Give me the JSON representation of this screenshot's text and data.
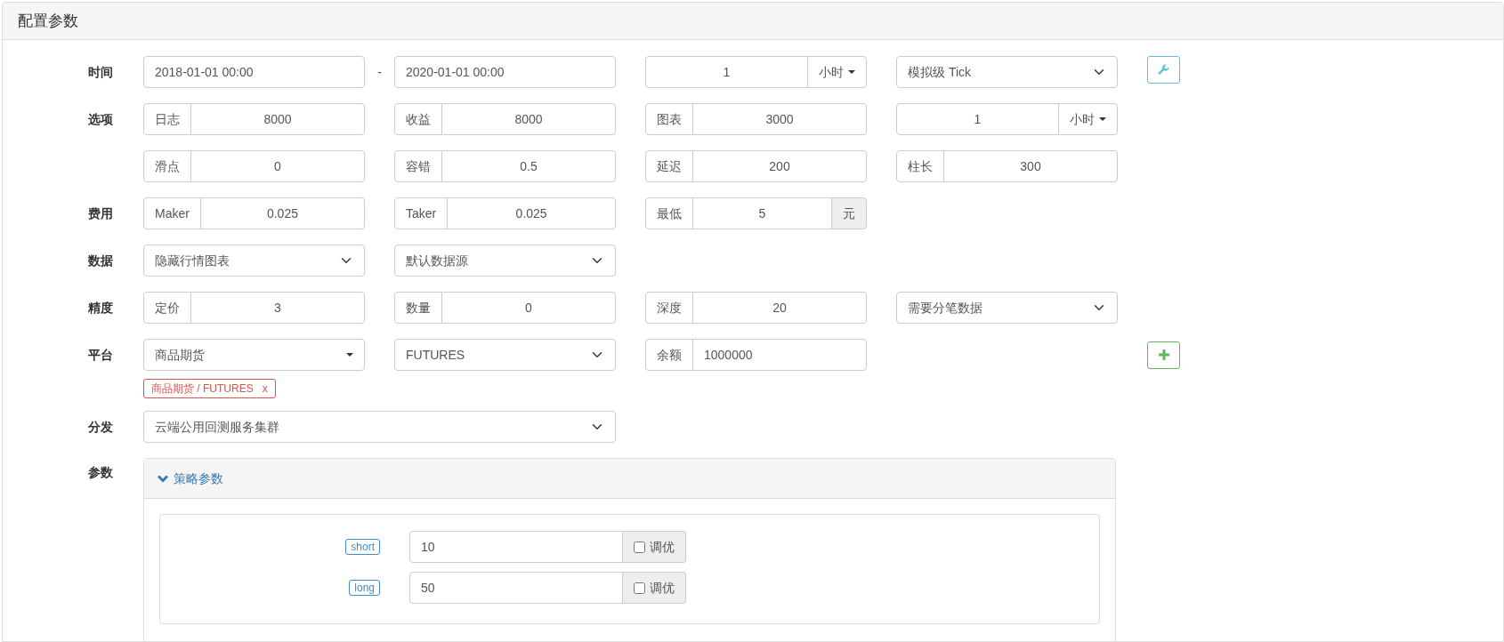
{
  "panel_title": "配置参数",
  "rows": [
    {
      "label": "时间",
      "separator": "-",
      "action": {
        "kind": "settings"
      },
      "cells": [
        {
          "kind": "date",
          "value": "2018-01-01 00:00"
        },
        {
          "kind": "date",
          "value": "2020-01-01 00:00"
        },
        {
          "kind": "number-unit",
          "value": "1",
          "unit": "小时"
        },
        {
          "kind": "select",
          "value": "模拟级 Tick"
        }
      ]
    },
    {
      "label": "选项",
      "cells": [
        {
          "kind": "addon",
          "prefix": "日志",
          "value": "8000"
        },
        {
          "kind": "addon",
          "prefix": "收益",
          "value": "8000"
        },
        {
          "kind": "addon",
          "prefix": "图表",
          "value": "3000"
        },
        {
          "kind": "number-unit",
          "value": "1",
          "unit": "小时"
        }
      ]
    },
    {
      "cells": [
        {
          "kind": "addon",
          "prefix": "滑点",
          "value": "0"
        },
        {
          "kind": "addon",
          "prefix": "容错",
          "value": "0.5"
        },
        {
          "kind": "addon",
          "prefix": "延迟",
          "value": "200"
        },
        {
          "kind": "addon",
          "prefix": "柱长",
          "value": "300"
        }
      ]
    },
    {
      "label": "费用",
      "cells": [
        {
          "kind": "addon",
          "prefix": "Maker",
          "value": "0.025"
        },
        {
          "kind": "addon",
          "prefix": "Taker",
          "value": "0.025"
        },
        {
          "kind": "addon",
          "prefix": "最低",
          "value": "5",
          "suffix": "元"
        }
      ]
    },
    {
      "label": "数据",
      "cells": [
        {
          "kind": "select",
          "value": "隐藏行情图表"
        },
        {
          "kind": "select",
          "value": "默认数据源"
        }
      ]
    },
    {
      "label": "精度",
      "cells": [
        {
          "kind": "addon",
          "prefix": "定价",
          "value": "3"
        },
        {
          "kind": "addon",
          "prefix": "数量",
          "value": "0"
        },
        {
          "kind": "addon",
          "prefix": "深度",
          "value": "20"
        },
        {
          "kind": "select",
          "value": "需要分笔数据"
        }
      ]
    },
    {
      "label": "平台",
      "action": {
        "kind": "add"
      },
      "cells": [
        {
          "kind": "dropdown",
          "value": "商品期货"
        },
        {
          "kind": "select",
          "value": "FUTURES"
        },
        {
          "kind": "addon-text",
          "prefix": "余额",
          "value": "1000000"
        }
      ],
      "tags": [
        {
          "text": "商品期货 / FUTURES",
          "close": "x"
        }
      ]
    },
    {
      "label": "分发",
      "cells": [
        {
          "kind": "select-wide",
          "value": "云端公用回测服务集群"
        }
      ]
    }
  ],
  "params": {
    "label": "参数",
    "title": "策略参数",
    "expanded": true,
    "items": [
      {
        "name": "short",
        "value": "10",
        "option": "调优",
        "checked": false
      },
      {
        "name": "long",
        "value": "50",
        "option": "调优",
        "checked": false
      }
    ]
  }
}
